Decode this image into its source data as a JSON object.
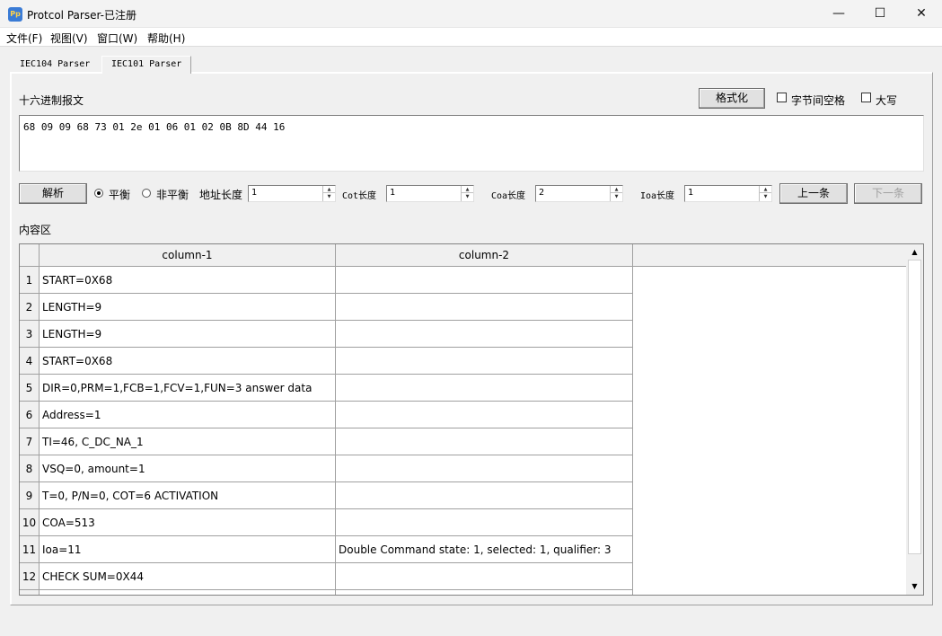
{
  "window": {
    "title": "Protcol Parser-已注册",
    "icon_text": "Pp",
    "minimize_glyph": "—",
    "maximize_glyph": "☐",
    "close_glyph": "✕"
  },
  "menu": [
    "文件(F)",
    "视图(V)",
    "窗口(W)",
    "帮助(H)"
  ],
  "tabs": [
    {
      "label": "IEC104 Parser",
      "active": false
    },
    {
      "label": "IEC101 Parser",
      "active": true
    }
  ],
  "hex_section": {
    "label": "十六进制报文",
    "format_button": "格式化",
    "byte_space_label": "字节间空格",
    "uppercase_label": "大写",
    "hex_value": "68 09 09 68 73 01 2e 01 06 01 02 0B 8D 44 16"
  },
  "controls": {
    "parse_button": "解析",
    "balanced_label": "平衡",
    "unbalanced_label": "非平衡",
    "mode_selected": "平衡",
    "addr_len_label": "地址长度",
    "addr_len_value": "1",
    "cot_len_label": "Cot长度",
    "cot_len_value": "1",
    "coa_len_label": "Coa长度",
    "coa_len_value": "2",
    "ioa_len_label": "Ioa长度",
    "ioa_len_value": "1",
    "prev_button": "上一条",
    "next_button": "下一条"
  },
  "content": {
    "label": "内容区",
    "columns": [
      "column-1",
      "column-2"
    ],
    "rows": [
      {
        "n": "1",
        "c1": "START=0X68",
        "c2": ""
      },
      {
        "n": "2",
        "c1": "LENGTH=9",
        "c2": ""
      },
      {
        "n": "3",
        "c1": "LENGTH=9",
        "c2": ""
      },
      {
        "n": "4",
        "c1": "START=0X68",
        "c2": ""
      },
      {
        "n": "5",
        "c1": "DIR=0,PRM=1,FCB=1,FCV=1,FUN=3 answer data",
        "c2": ""
      },
      {
        "n": "6",
        "c1": "Address=1",
        "c2": ""
      },
      {
        "n": "7",
        "c1": "TI=46, C_DC_NA_1",
        "c2": ""
      },
      {
        "n": "8",
        "c1": "VSQ=0, amount=1",
        "c2": ""
      },
      {
        "n": "9",
        "c1": "T=0, P/N=0, COT=6 ACTIVATION",
        "c2": ""
      },
      {
        "n": "10",
        "c1": "COA=513",
        "c2": ""
      },
      {
        "n": "11",
        "c1": "Ioa=11",
        "c2": "Double Command state: 1, selected: 1, qualifier: 3"
      },
      {
        "n": "12",
        "c1": "CHECK SUM=0X44",
        "c2": ""
      }
    ]
  },
  "icons": {
    "radio_on": "radio-checked-icon",
    "spin_up": "▲",
    "spin_down": "▼",
    "scroll_up": "▲",
    "scroll_down": "▼"
  }
}
